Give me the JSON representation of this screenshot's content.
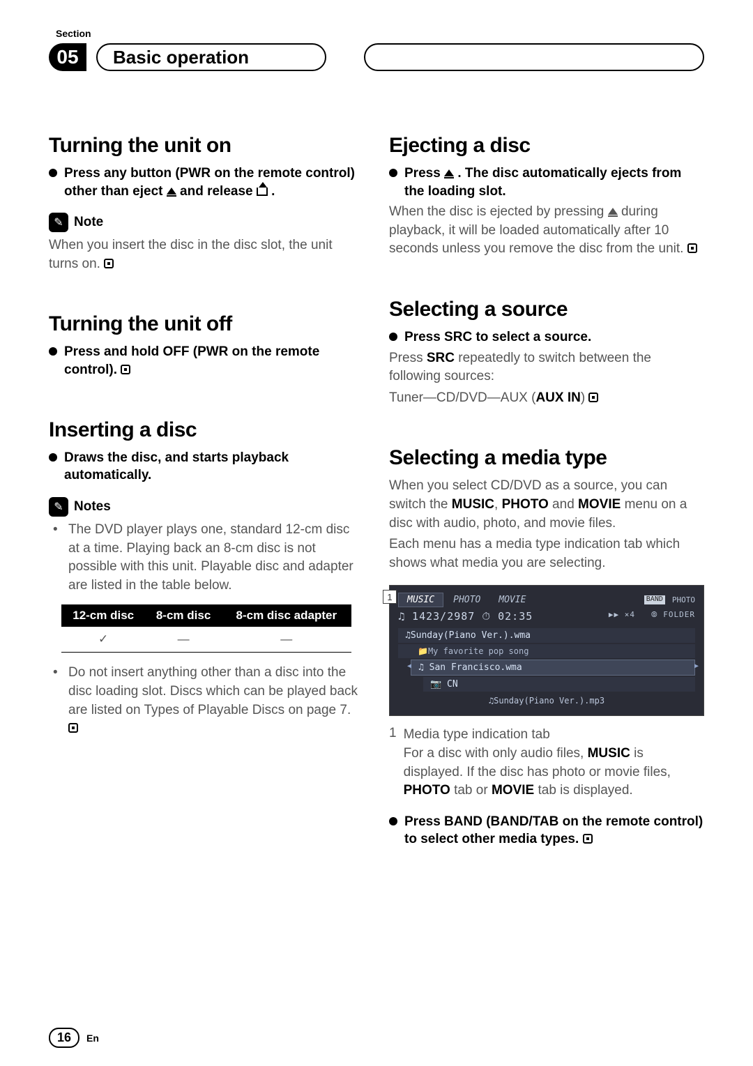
{
  "header": {
    "section_label": "Section",
    "chapter_number": "05",
    "chapter_title": "Basic operation"
  },
  "left": {
    "s1": {
      "title": "Turning the unit on",
      "bullet_pre": "Press any button (PWR on the remote control) other than eject ",
      "bullet_mid": " and release ",
      "bullet_end": ".",
      "note_label": "Note",
      "note_text_pre": "When you insert the disc in the disc slot, the unit turns on."
    },
    "s2": {
      "title": "Turning the unit off",
      "bullet": "Press and hold OFF (PWR on the remote control)."
    },
    "s3": {
      "title": "Inserting a disc",
      "bullet": "Draws the disc, and starts playback automatically.",
      "notes_label": "Notes",
      "li1": "The DVD player plays one, standard 12-cm disc at a time. Playing back an 8-cm disc is not possible with this unit. Playable disc and adapter are listed in the table below.",
      "table": {
        "h1": "12-cm disc",
        "h2": "8-cm disc",
        "h3": "8-cm disc adapter",
        "c1": "✓",
        "c2": "—",
        "c3": "—"
      },
      "li2_pre": "Do not insert anything other than a disc into the disc loading slot. Discs which can be played back are listed on ",
      "li2_italic": "Types of Playable Discs",
      "li2_post": " on page 7."
    }
  },
  "right": {
    "s1": {
      "title": "Ejecting a disc",
      "bullet_pre": "Press ",
      "bullet_post": ". The disc automatically ejects from the loading slot.",
      "body_pre": "When the disc is ejected by pressing ",
      "body_post": " during playback, it will be loaded automatically after 10 seconds unless you remove the disc from the unit."
    },
    "s2": {
      "title": "Selecting a source",
      "bullet": "Press SRC to select a source.",
      "body_pre": "Press ",
      "body_src": "SRC",
      "body_post": " repeatedly to switch between the following sources:",
      "line2_pre": "Tuner—CD/DVD—AUX (",
      "line2_bold": "AUX IN",
      "line2_post": ")"
    },
    "s3": {
      "title": "Selecting a media type",
      "p1_pre": "When you select CD/DVD as a source, you can switch the ",
      "p1_music": "MUSIC",
      "p1_sep1": ", ",
      "p1_photo": "PHOTO",
      "p1_sep2": " and ",
      "p1_movie": "MOVIE",
      "p1_post": " menu on a disc with audio, photo, and movie files.",
      "p2": "Each menu has a media type indication tab which shows what media you are selecting.",
      "screenshot": {
        "callout": "1",
        "tabs": {
          "music": "MUSIC",
          "photo": "PHOTO",
          "movie": "MOVIE"
        },
        "right_badge": "BAND",
        "right_text": "PHOTO",
        "info_left": "♫ 1423/2987   ⏱ 02:35",
        "info_right1": "▶▶ ×4",
        "info_right2": "⦾ FOLDER",
        "item1": "♫Sunday(Piano Ver.).wma",
        "item1_sub": "📁My favorite pop song",
        "item2": "♫ San Francisco.wma",
        "item3": "📷 CN",
        "footer": "♫Sunday(Piano Ver.).mp3"
      },
      "caption_num": "1",
      "caption_title": "Media type indication tab",
      "caption_pre": "For a disc with only audio files, ",
      "caption_music": "MUSIC",
      "caption_mid": " is displayed. If the disc has photo or movie files, ",
      "caption_photo": "PHOTO",
      "caption_or": " tab or ",
      "caption_movie": "MOVIE",
      "caption_post": " tab is displayed.",
      "bullet2": "Press BAND (BAND/TAB on the remote control) to select other media types."
    }
  },
  "footer": {
    "page": "16",
    "lang": "En"
  }
}
